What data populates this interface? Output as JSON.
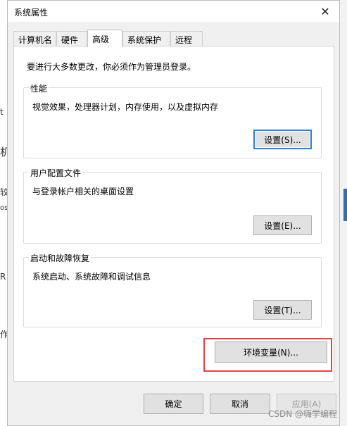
{
  "window": {
    "title": "系统属性",
    "close_symbol": "✕"
  },
  "tabs": [
    {
      "label": "计算机名"
    },
    {
      "label": "硬件"
    },
    {
      "label": "高级",
      "active": true
    },
    {
      "label": "系统保护"
    },
    {
      "label": "远程"
    }
  ],
  "admin_note": "要进行大多数更改，你必须作为管理员登录。",
  "groups": {
    "performance": {
      "title": "性能",
      "description": "视觉效果，处理器计划，内存使用，以及虚拟内存",
      "button": "设置(S)..."
    },
    "user_profiles": {
      "title": "用户配置文件",
      "description": "与登录帐户相关的桌面设置",
      "button": "设置(E)..."
    },
    "startup_recovery": {
      "title": "启动和故障恢复",
      "description": "系统启动、系统故障和调试信息",
      "button": "设置(T)..."
    }
  },
  "env_button": "环境变量(N)...",
  "footer": {
    "ok": "确定",
    "cancel": "取消",
    "apply": "应用(A)"
  },
  "watermark": "CSDN @嗨学编程",
  "background_fragments": [
    "t",
    "机",
    "较",
    "os",
    "R",
    "作"
  ],
  "colors": {
    "focus_border": "#2a7fd4",
    "highlight_border": "#e24444"
  }
}
